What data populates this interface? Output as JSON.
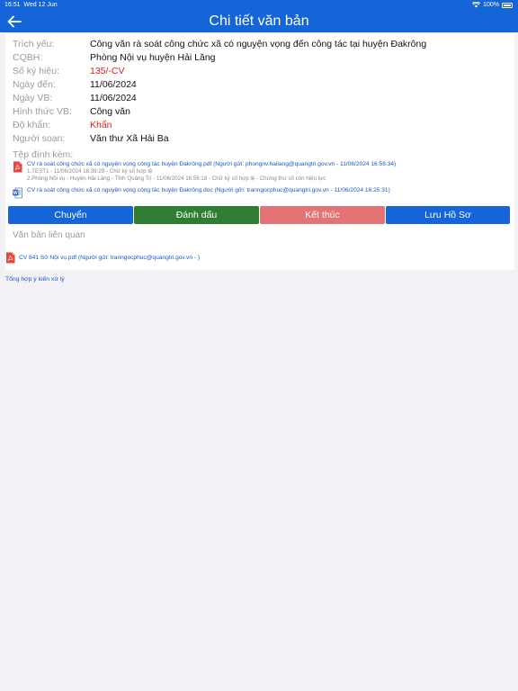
{
  "status_bar": {
    "time": "16:51",
    "date": "Wed 12 Jun",
    "battery": "100%"
  },
  "navbar": {
    "title": "Chi tiết văn bản"
  },
  "document": {
    "fields": [
      {
        "label": "Trích yếu:",
        "value": "Công văn rà soát công chức xã có nguyện vọng đến công tác tại huyện Đakrông"
      },
      {
        "label": "CQBH:",
        "value": "Phòng Nội vụ huyện Hải Lăng"
      },
      {
        "label": "Số ký hiệu:",
        "value": "135/-CV",
        "highlight": true
      },
      {
        "label": "Ngày đến:",
        "value": "11/06/2024"
      },
      {
        "label": "Ngày VB:",
        "value": "11/06/2024"
      },
      {
        "label": "Hình thức VB:",
        "value": "Công văn"
      },
      {
        "label": "Độ khẩn:",
        "value": "Khẩn",
        "highlight": true
      },
      {
        "label": "Người soạn:",
        "value": "Văn thư Xã Hải Ba"
      }
    ]
  },
  "attachments": {
    "title": "Tệp đính kèm:",
    "files": [
      {
        "type": "pdf",
        "name": "CV rà soát công chức xã có nguyện vọng công tác huyện Đakrông.pdf (Người gửi: phongnv.hailang@quangtri.gov.vn - 11/06/2024 16:56:34)",
        "signatures": [
          "1.TEST1 - 11/06/2024 16:39:29 - Chữ ký số hợp lệ",
          "2.Phòng Nội vụ - Huyện Hải Lăng - Tỉnh Quảng Trị - 11/06/2024 16:56:18 - Chữ ký số hợp lệ - Chứng thư số còn hiệu lực"
        ]
      },
      {
        "type": "doc",
        "name": "CV rà soát công chức xã có nguyện vọng công tác huyện Đakrông.doc (Người gửi: tranngocphuc@quangtri.gov.vn - 11/06/2024 16:25:31)",
        "signatures": []
      }
    ]
  },
  "actions": [
    {
      "label": "Chuyển",
      "color": "#1665d8"
    },
    {
      "label": "Đánh dấu",
      "color": "#2e7d32"
    },
    {
      "label": "Kết thúc",
      "color": "#e57373"
    },
    {
      "label": "Lưu Hồ Sơ",
      "color": "#1665d8"
    }
  ],
  "related": {
    "title": "Văn bản liên quan",
    "files": [
      {
        "type": "pdf",
        "name": "CV 841 Sở Nội vụ.pdf (Người gửi: tranngocphuc@quangtri.gov.vn - )"
      }
    ]
  },
  "summary_link": "Tổng hợp ý kiến xử lý"
}
